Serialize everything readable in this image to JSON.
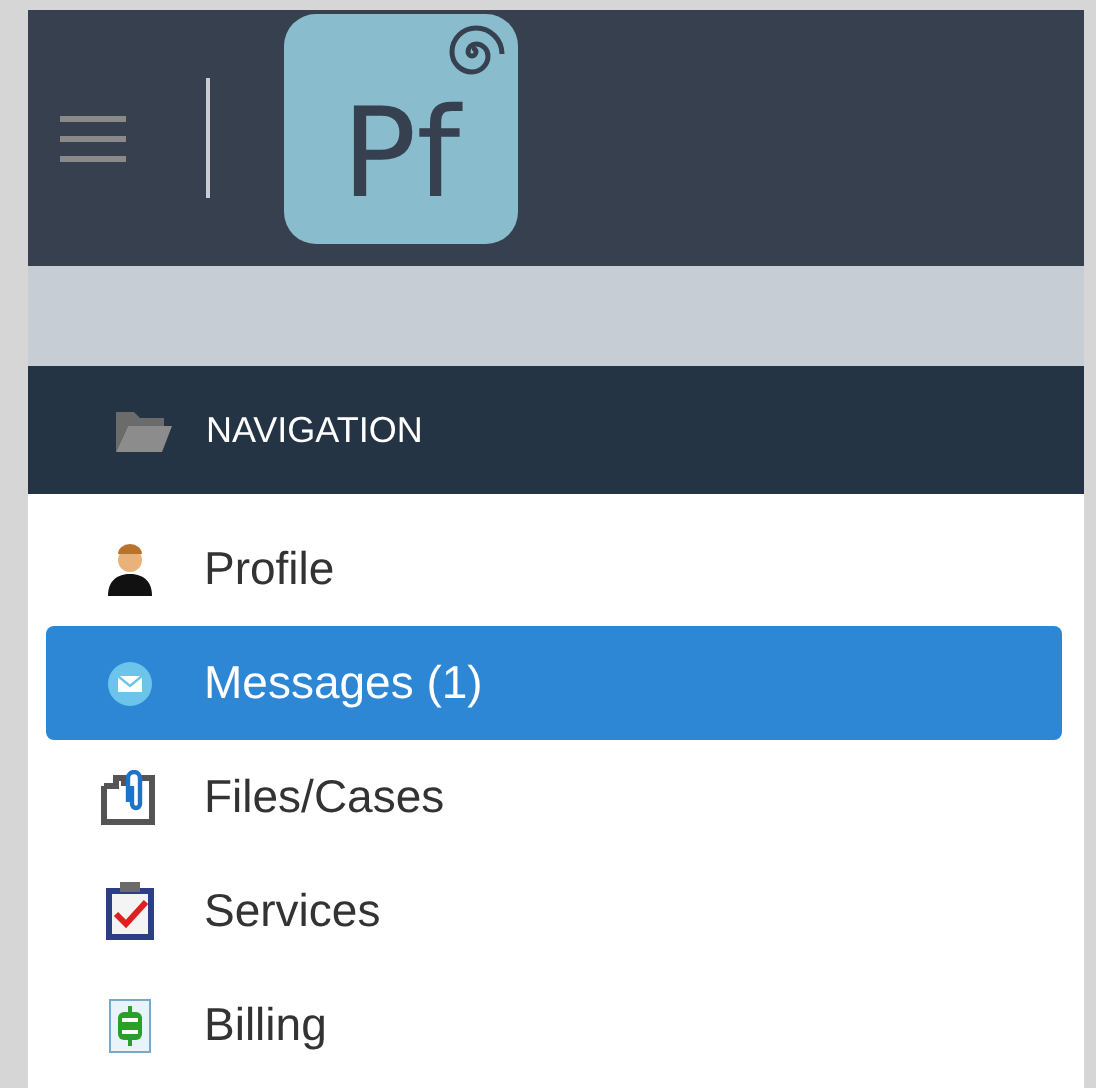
{
  "header": {
    "logo_text": "Pf"
  },
  "navigation": {
    "title": "NAVIGATION",
    "items": [
      {
        "label": "Profile",
        "kind": "person",
        "selected": false
      },
      {
        "label": "Messages (1)",
        "kind": "envelope",
        "selected": true
      },
      {
        "label": "Files/Cases",
        "kind": "files",
        "selected": false
      },
      {
        "label": "Services",
        "kind": "clipboard",
        "selected": false
      },
      {
        "label": "Billing",
        "kind": "billing",
        "selected": false
      }
    ]
  }
}
